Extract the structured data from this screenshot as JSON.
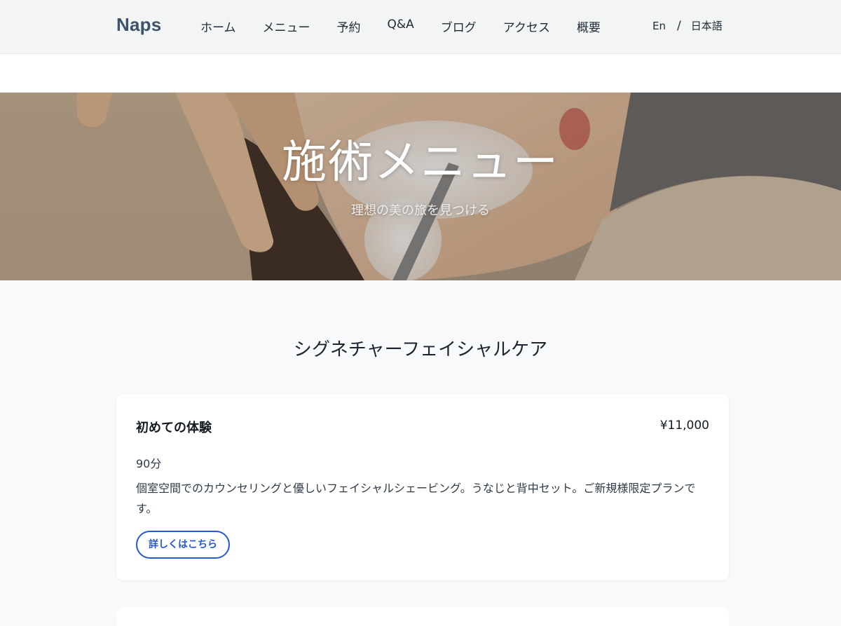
{
  "nav": {
    "brand": "Naps",
    "links": [
      "ホーム",
      "メニュー",
      "予約",
      "Q&A",
      "ブログ",
      "アクセス",
      "概要"
    ],
    "lang": {
      "en": "En",
      "separator": "/",
      "ja": "日本語"
    }
  },
  "hero": {
    "title": "施術メニュー",
    "subtitle": "理想の美の旅を見つける"
  },
  "section": {
    "heading": "シグネチャーフェイシャルケア"
  },
  "menu_items": [
    {
      "title": "初めての体験",
      "price": "¥11,000",
      "duration": "90分",
      "description": "個室空間でのカウンセリングと優しいフェイシャルシェービング。うなじと背中セット。ご新規様限定プランです。",
      "button_label": "詳しくはこちら"
    }
  ],
  "colors": {
    "brand": "#3e526b",
    "accent": "#2458d6",
    "page_background": "#f7f9fb",
    "nav_background": "#f3f5f5"
  }
}
